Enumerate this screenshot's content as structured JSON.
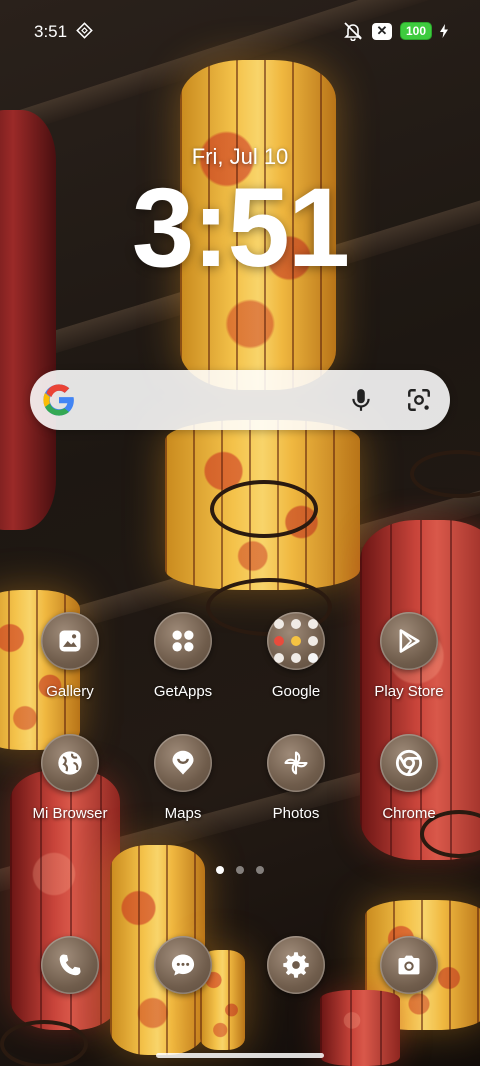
{
  "status_bar": {
    "time": "3:51",
    "battery": "100",
    "icons": [
      "cast-icon",
      "mute-icon",
      "x-badge",
      "battery",
      "charging-bolt-icon"
    ]
  },
  "clock": {
    "date": "Fri, Jul 10",
    "time": "3:51"
  },
  "search": {
    "icons": [
      "google-logo",
      "mic-icon",
      "google-lens-icon"
    ]
  },
  "apps": [
    {
      "label": "Gallery",
      "icon": "gallery-icon"
    },
    {
      "label": "GetApps",
      "icon": "getapps-icon"
    },
    {
      "label": "Google",
      "icon": "folder-icon"
    },
    {
      "label": "Play Store",
      "icon": "play-store-icon"
    },
    {
      "label": "Mi Browser",
      "icon": "globe-icon"
    },
    {
      "label": "Maps",
      "icon": "maps-pin-icon"
    },
    {
      "label": "Photos",
      "icon": "pinwheel-icon"
    },
    {
      "label": "Chrome",
      "icon": "chrome-icon"
    }
  ],
  "pager": {
    "pages": 3,
    "current": 1
  },
  "dock": [
    {
      "icon": "phone-icon"
    },
    {
      "icon": "messages-icon"
    },
    {
      "icon": "settings-icon"
    },
    {
      "icon": "camera-icon"
    }
  ]
}
